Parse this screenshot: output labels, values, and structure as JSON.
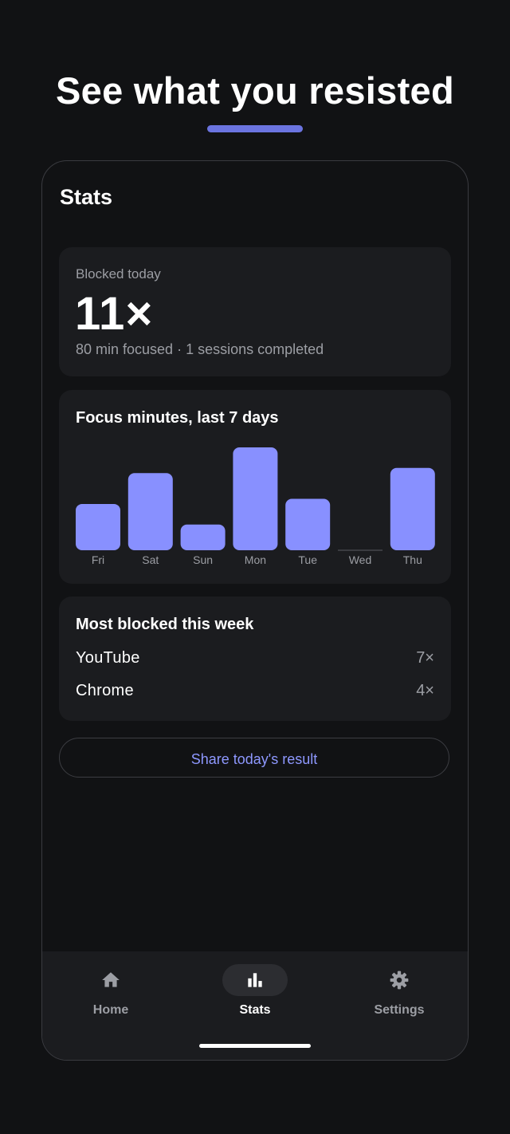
{
  "hero": {
    "title": "See what you resisted"
  },
  "screen": {
    "title": "Stats"
  },
  "blocked_today": {
    "label": "Blocked today",
    "count": "11×",
    "subtitle": "80 min focused · 1 sessions completed"
  },
  "focus_chart": {
    "title": "Focus minutes, last 7 days"
  },
  "chart_data": {
    "type": "bar",
    "title": "Focus minutes, last 7 days",
    "categories": [
      "Fri",
      "Sat",
      "Sun",
      "Mon",
      "Tue",
      "Wed",
      "Thu"
    ],
    "values": [
      45,
      75,
      25,
      100,
      50,
      0,
      80
    ],
    "bar_color": "#8890ff",
    "grid": false
  },
  "most_blocked": {
    "title": "Most blocked this week",
    "items": [
      {
        "name": "YouTube",
        "count": "7×"
      },
      {
        "name": "Chrome",
        "count": "4×"
      }
    ]
  },
  "share_button": {
    "label": "Share today's result"
  },
  "nav": {
    "items": [
      {
        "label": "Home",
        "icon": "home-icon"
      },
      {
        "label": "Stats",
        "icon": "bar-chart-icon",
        "active": true
      },
      {
        "label": "Settings",
        "icon": "gear-icon"
      }
    ]
  },
  "colors": {
    "background": "#111214",
    "card": "#1b1c1f",
    "accent": "#8890ff",
    "underline": "#6b74e0",
    "muted_text": "#9c9ea4"
  }
}
